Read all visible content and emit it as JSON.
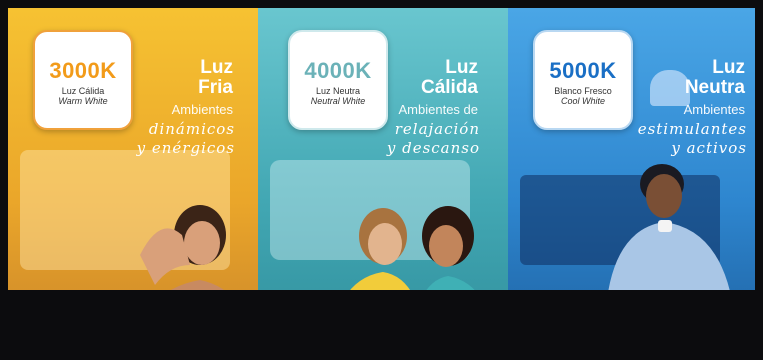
{
  "panels": [
    {
      "temp": "3000K",
      "name_es": "Luz Cálida",
      "name_en": "Warm White",
      "title_line1": "Luz",
      "title_line2": "Fria",
      "subtitle": "Ambientes",
      "script_line1": "dinámicos",
      "script_line2": "y enérgicos",
      "accent": "#f29b1a"
    },
    {
      "temp": "4000K",
      "name_es": "Luz Neutra",
      "name_en": "Neutral White",
      "title_line1": "Luz",
      "title_line2": "Cálida",
      "subtitle": "Ambientes de",
      "script_line1": "relajación",
      "script_line2": "y descanso",
      "accent": "#6bb2b8"
    },
    {
      "temp": "5000K",
      "name_es": "Blanco Fresco",
      "name_en": "Cool White",
      "title_line1": "Luz",
      "title_line2": "Neutra",
      "subtitle": "Ambientes",
      "script_line1": "estimulantes",
      "script_line2": "y activos",
      "accent": "#1a6fc5"
    }
  ]
}
